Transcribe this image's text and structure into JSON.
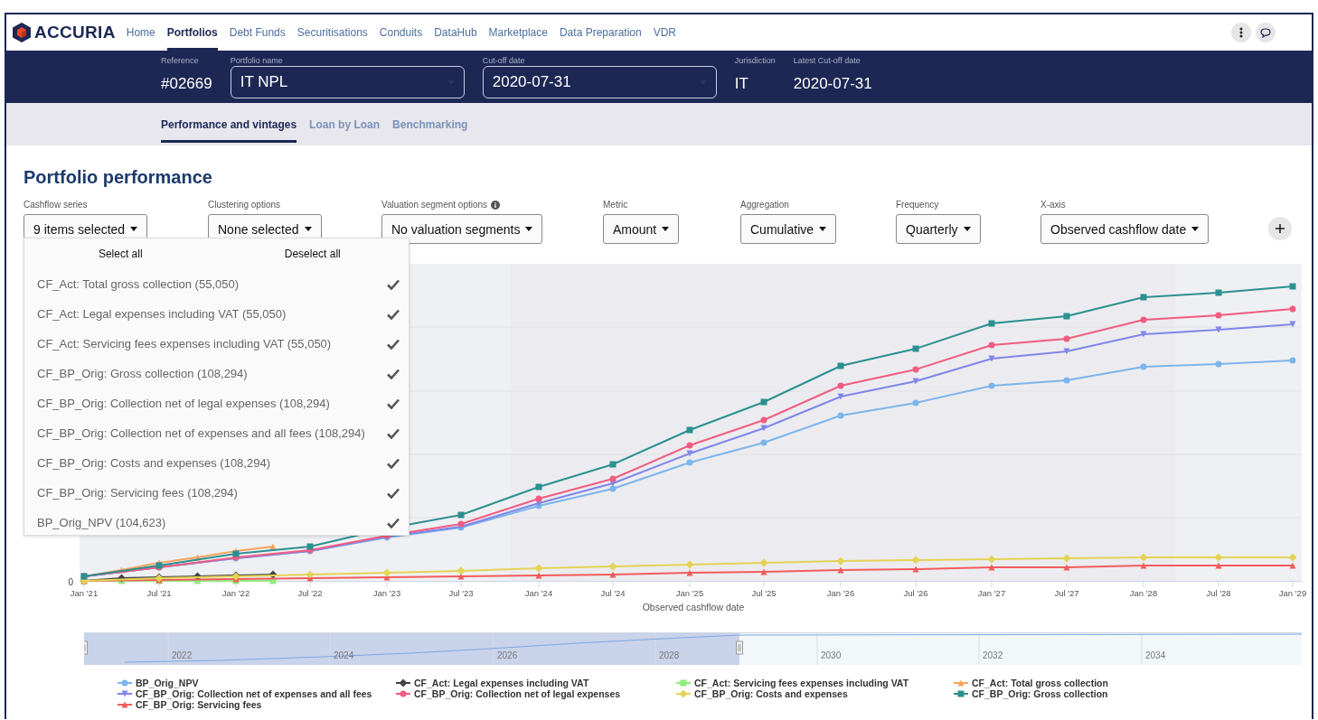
{
  "nav": {
    "logo": "ACCURIA",
    "items": [
      {
        "label": "Home",
        "selected": false
      },
      {
        "label": "Portfolios",
        "selected": true
      },
      {
        "label": "Debt Funds",
        "selected": false
      },
      {
        "label": "Securitisations",
        "selected": false
      },
      {
        "label": "Conduits",
        "selected": false
      },
      {
        "label": "DataHub",
        "selected": false
      },
      {
        "label": "Marketplace",
        "selected": false
      },
      {
        "label": "Data Preparation",
        "selected": false
      },
      {
        "label": "VDR",
        "selected": false
      }
    ]
  },
  "header": {
    "fields": [
      {
        "kind": "text",
        "label": "Reference",
        "value": "#02669"
      },
      {
        "kind": "select",
        "label": "Portfolio name",
        "value": "IT NPL"
      },
      {
        "kind": "select",
        "label": "Cut-off date",
        "value": "2020-07-31"
      },
      {
        "kind": "text",
        "label": "Jurisdiction",
        "value": "IT"
      },
      {
        "kind": "text",
        "label": "Latest Cut-off date",
        "value": "2020-07-31"
      }
    ]
  },
  "subtabs": [
    {
      "label": "Performance and vintages",
      "selected": true
    },
    {
      "label": "Loan by Loan",
      "selected": false
    },
    {
      "label": "Benchmarking",
      "selected": false
    }
  ],
  "section_title": "Portfolio performance",
  "filters": [
    {
      "label": "Cashflow series",
      "value": "9 items selected",
      "info": false
    },
    {
      "label": "Clustering options",
      "value": "None selected",
      "info": false
    },
    {
      "label": "Valuation segment options",
      "value": "No valuation segments",
      "info": true
    },
    {
      "label": "Metric",
      "value": "Amount",
      "info": false
    },
    {
      "label": "Aggregation",
      "value": "Cumulative",
      "info": false
    },
    {
      "label": "Frequency",
      "value": "Quarterly",
      "info": false
    },
    {
      "label": "X-axis",
      "value": "Observed cashflow date",
      "info": false
    }
  ],
  "series_menu": {
    "select_all": "Select all",
    "deselect_all": "Deselect all",
    "items": [
      {
        "label": "CF_Act: Total gross collection (55,050)",
        "checked": true
      },
      {
        "label": "CF_Act: Legal expenses including VAT (55,050)",
        "checked": true
      },
      {
        "label": "CF_Act: Servicing fees expenses including VAT (55,050)",
        "checked": true
      },
      {
        "label": "CF_BP_Orig: Gross collection (108,294)",
        "checked": true
      },
      {
        "label": "CF_BP_Orig: Collection net of legal expenses (108,294)",
        "checked": true
      },
      {
        "label": "CF_BP_Orig: Collection net of expenses and all fees (108,294)",
        "checked": true
      },
      {
        "label": "CF_BP_Orig: Costs and expenses (108,294)",
        "checked": true
      },
      {
        "label": "CF_BP_Orig: Servicing fees (108,294)",
        "checked": true
      },
      {
        "label": "BP_Orig_NPV (104,623)",
        "checked": true
      }
    ]
  },
  "chart": {
    "y_tick": "0",
    "x_ticks": [
      "Jan '21",
      "Jul '21",
      "Jan '22",
      "Jul '22",
      "Jan '23",
      "Jul '23",
      "Jan '24",
      "Jul '24",
      "Jan '25",
      "Jul '25",
      "Jan '26",
      "Jul '26",
      "Jan '27",
      "Jul '27",
      "Jan '28",
      "Jul '28",
      "Jan '29"
    ],
    "x_title": "Observed cashflow date",
    "navigator_labels": [
      "2022",
      "2024",
      "2026",
      "2028",
      "2030",
      "2032",
      "2034"
    ],
    "legend": [
      {
        "name": "BP_Orig_NPV",
        "color": "#7cb5ec",
        "kind": "circle"
      },
      {
        "name": "CF_Act: Legal expenses including VAT",
        "color": "#434348",
        "kind": "diamond"
      },
      {
        "name": "CF_Act: Servicing fees expenses including VAT",
        "color": "#90ed7d",
        "kind": "square"
      },
      {
        "name": "CF_Act: Total gross collection",
        "color": "#f7a35c",
        "kind": "triangle"
      },
      {
        "name": "CF_BP_Orig: Collection net of expenses and all fees",
        "color": "#8085e9",
        "kind": "triangle-down"
      },
      {
        "name": "CF_BP_Orig: Collection net of legal expenses",
        "color": "#f15c80",
        "kind": "circle"
      },
      {
        "name": "CF_BP_Orig: Costs and expenses",
        "color": "#e4d354",
        "kind": "diamond"
      },
      {
        "name": "CF_BP_Orig: Gross collection",
        "color": "#2b908f",
        "kind": "square"
      },
      {
        "name": "CF_BP_Orig: Servicing fees",
        "color": "#f45b5b",
        "kind": "triangle"
      }
    ]
  }
}
